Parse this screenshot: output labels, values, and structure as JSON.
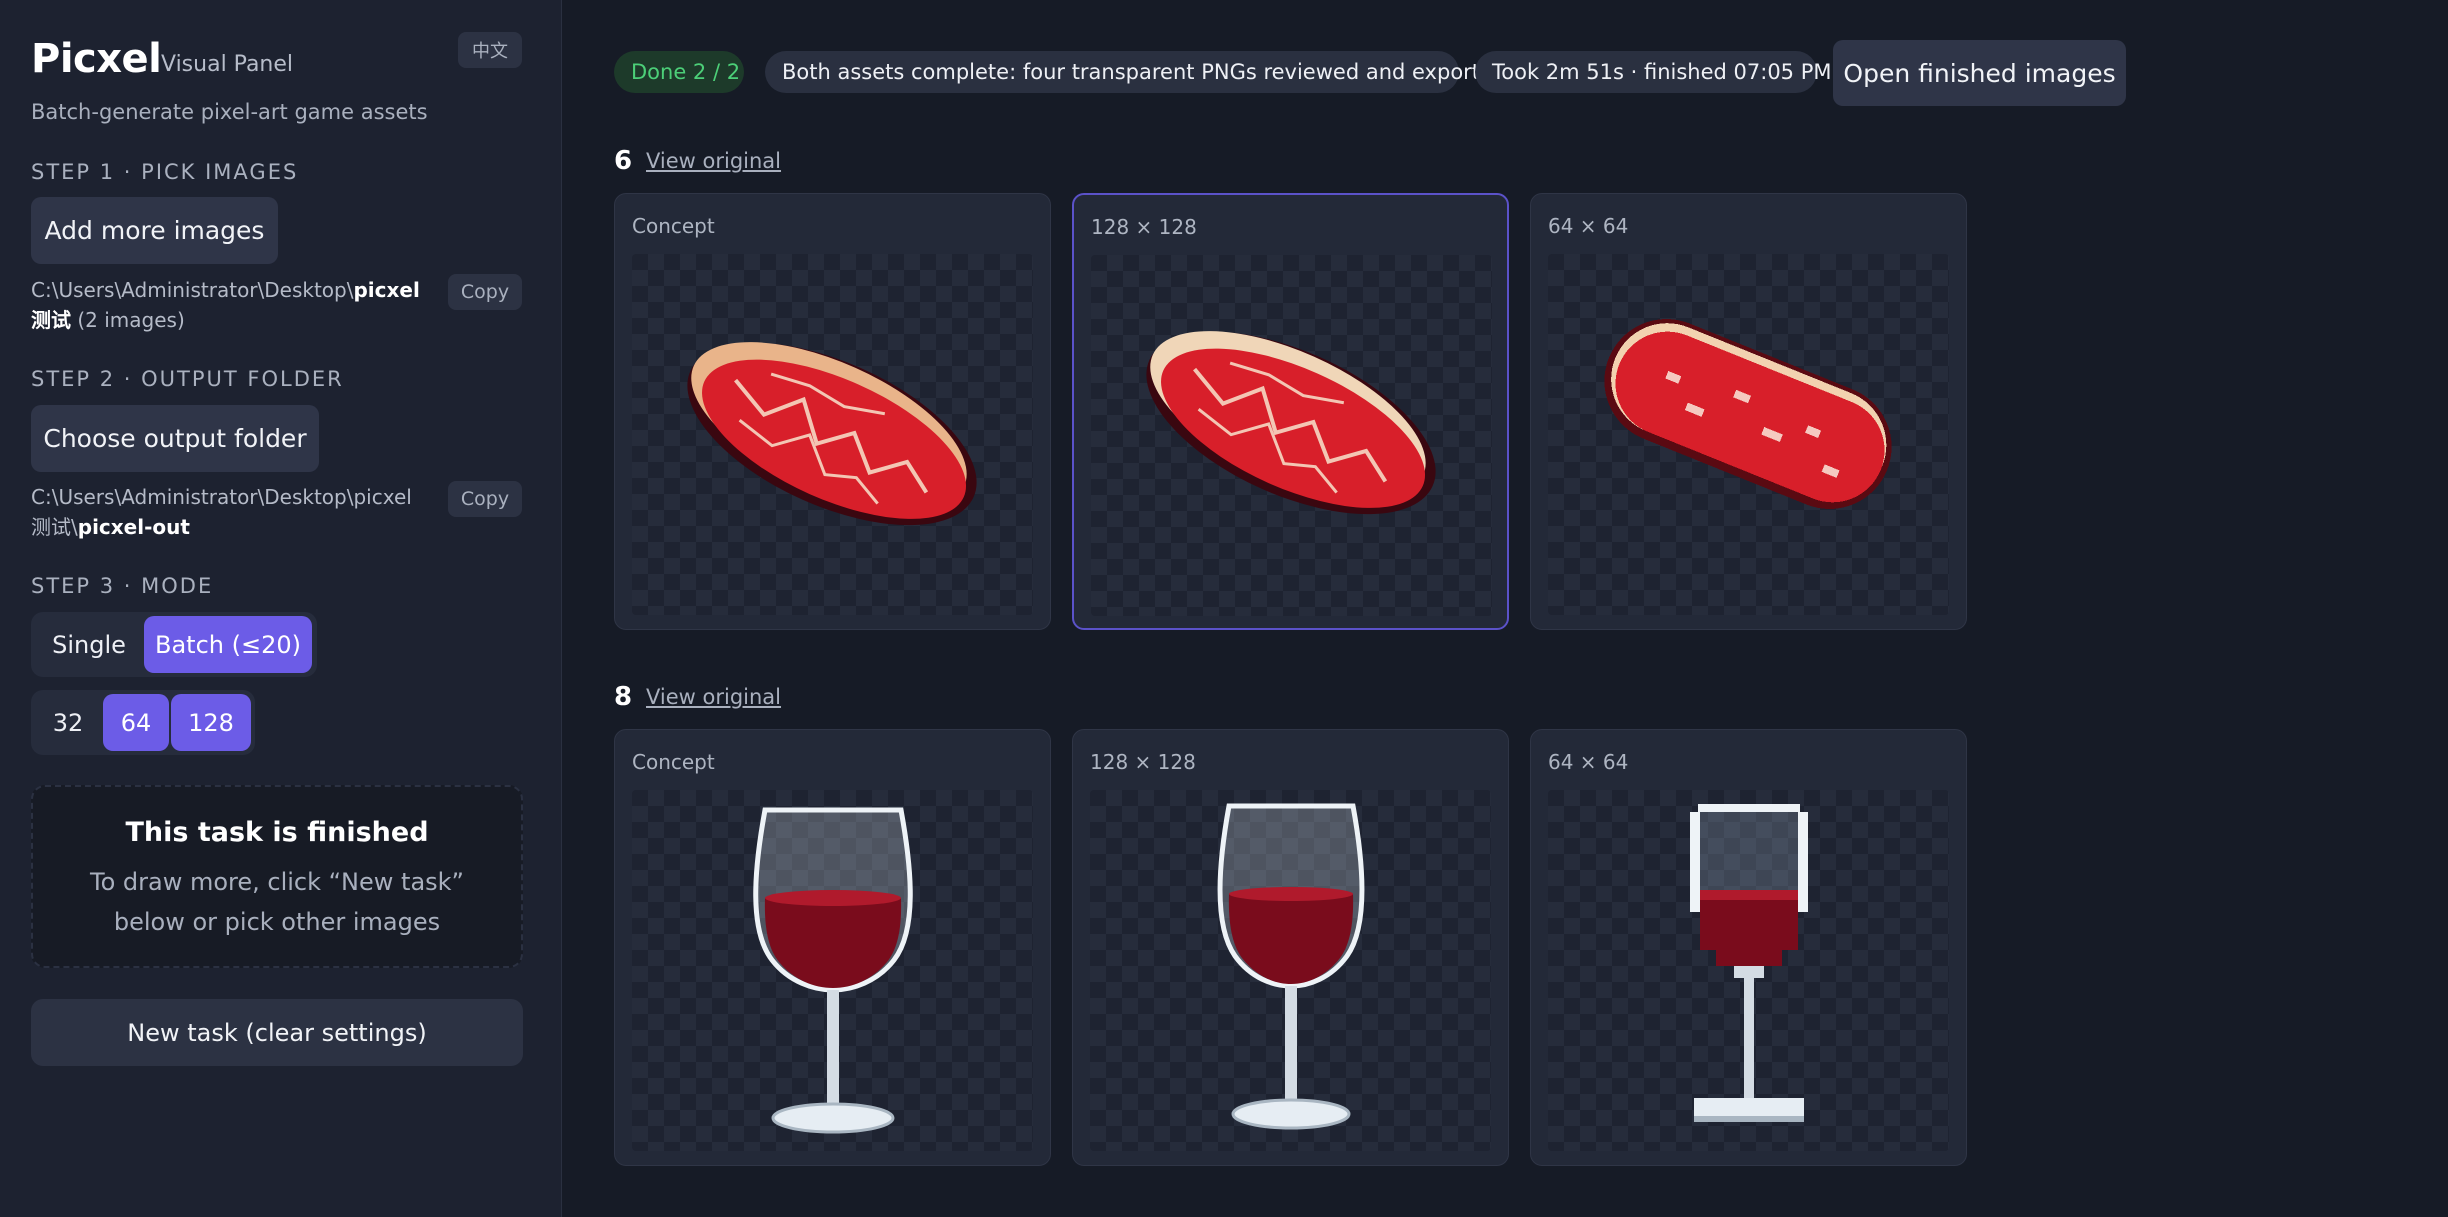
{
  "sidebar": {
    "brand": "Picxel",
    "brand_sub": "Visual Panel",
    "lang_toggle": "中文",
    "tagline": "Batch-generate pixel-art game assets",
    "step1": {
      "label": "STEP 1 · PICK IMAGES",
      "button": "Add more images",
      "path_prefix": "C:\\Users\\Administrator\\Desktop\\",
      "path_bold": "picxel测试",
      "path_suffix": " (2 images)",
      "copy": "Copy"
    },
    "step2": {
      "label": "STEP 2 · OUTPUT FOLDER",
      "button": "Choose output folder",
      "path_prefix": "C:\\Users\\Administrator\\Desktop\\picxel测试\\",
      "path_bold": "picxel-out",
      "copy": "Copy"
    },
    "step3": {
      "label": "STEP 3 · MODE",
      "modes": [
        "Single",
        "Batch (≤20)"
      ],
      "selected_mode": "Batch (≤20)",
      "sizes": [
        "32",
        "64",
        "128"
      ],
      "selected_sizes": [
        "64",
        "128"
      ]
    },
    "finished": {
      "title": "This task is finished",
      "desc": "To draw more, click “New task” below or pick other images"
    },
    "new_task": "New task (clear settings)"
  },
  "status": {
    "progress": "Done 2 / 2",
    "message": "Both assets complete: four transparent PNGs reviewed and exported.",
    "timing": "Took 2m 51s · finished 07:05 PM",
    "open_button": "Open finished images"
  },
  "colors": {
    "accent": "#6c5ce7",
    "success": "#4ccf78",
    "background": "#161b26",
    "sidebar": "#1d2230"
  },
  "groups": [
    {
      "number": "6",
      "link": "View original",
      "asset": "steak",
      "cards": [
        {
          "label": "Concept",
          "selected": false
        },
        {
          "label": "128 × 128",
          "selected": true
        },
        {
          "label": "64 × 64",
          "selected": false
        }
      ]
    },
    {
      "number": "8",
      "link": "View original",
      "asset": "wine-glass",
      "cards": [
        {
          "label": "Concept",
          "selected": false
        },
        {
          "label": "128 × 128",
          "selected": false
        },
        {
          "label": "64 × 64",
          "selected": false
        }
      ]
    }
  ]
}
